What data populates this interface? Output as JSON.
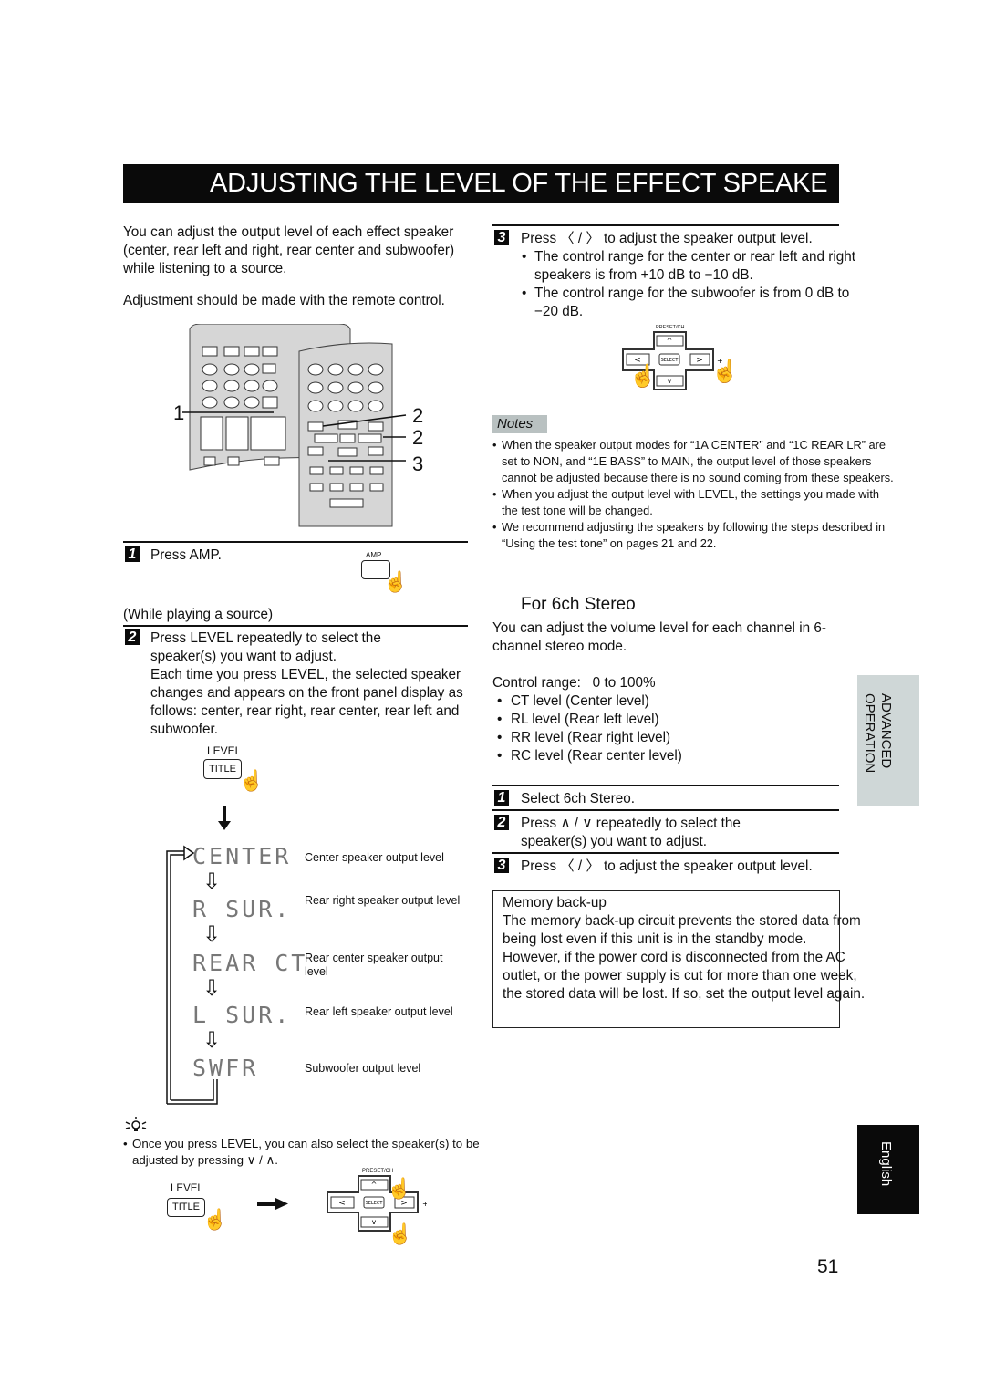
{
  "header": {
    "title": "ADJUSTING THE LEVEL OF THE EFFECT SPEAKE"
  },
  "intro": {
    "p1": "You can adjust the output level of each effect speaker (center, rear left and right, rear center and subwoofer) while listening to a source.",
    "p2": "Adjustment should be made with the remote control."
  },
  "remote_callouts": {
    "left": "1",
    "right_a": "2",
    "right_b": "2",
    "right_c": "3",
    "amp_label": "AMP"
  },
  "left_steps": {
    "step1_num": "1",
    "step1_text": "Press AMP.",
    "step1_key_label": "AMP",
    "while_playing": "(While playing a source)",
    "step2_num": "2",
    "step2_text": "Press LEVEL repeatedly to select the speaker(s) you want to adjust.",
    "step2_detail": "Each time you press LEVEL, the selected speaker changes and appears on the front panel display as follows: center, rear right, rear center, rear left and subwoofer.",
    "level_key_top": "LEVEL",
    "level_key_label": "TITLE"
  },
  "display_sequence": [
    {
      "lcd": "CENTER",
      "desc": "Center speaker output level"
    },
    {
      "lcd": "R SUR.",
      "desc": "Rear right speaker output level"
    },
    {
      "lcd": "REAR CT",
      "desc": "Rear center speaker output level"
    },
    {
      "lcd": "L SUR.",
      "desc": "Rear left speaker output level"
    },
    {
      "lcd": "SWFR",
      "desc": "Subwoofer output level"
    }
  ],
  "tip": {
    "icon": "lightbulb-icon",
    "text": "Once you press LEVEL, you can also select the speaker(s) to be adjusted by pressing ∨ / ∧.",
    "level_key_top": "LEVEL",
    "level_key_label": "TITLE",
    "preset_label": "PRESET/CH",
    "select_label": "SELECT",
    "plus": "+"
  },
  "right_step3": {
    "num": "3",
    "text": "Press 〈 / 〉 to adjust the speaker output level.",
    "bullets": [
      "The control range for the center or rear left and right speakers is from +10 dB to −10 dB.",
      "The control range for the subwoofer is from 0 dB to −20 dB."
    ],
    "preset_label": "PRESET/CH",
    "select_label": "SELECT",
    "plus": "+"
  },
  "notes": {
    "label": "Notes",
    "items": [
      "When the speaker output modes for “1A CENTER” and “1C REAR LR” are set to NON, and “1E BASS” to MAIN, the output level of those speakers cannot be adjusted because there is no sound coming from these speakers.",
      "When you adjust the output level with LEVEL, the settings you made with the test tone will be changed.",
      "We recommend adjusting the speakers by following the steps described in “Using the test tone” on pages 21 and 22."
    ]
  },
  "six_ch": {
    "heading": "For 6ch Stereo",
    "intro": "You can adjust the volume level for each channel in 6-channel stereo mode.",
    "control_range": "Control range:   0 to 100%",
    "levels": [
      "CT level  (Center level)",
      "RL level  (Rear left level)",
      "RR level  (Rear right level)",
      "RC level  (Rear center level)"
    ],
    "steps": [
      {
        "num": "1",
        "text": "Select 6ch Stereo."
      },
      {
        "num": "2",
        "text": "Press ∧ / ∨ repeatedly to select the speaker(s) you want to adjust."
      },
      {
        "num": "3",
        "text": "Press 〈 / 〉 to adjust the speaker output level."
      }
    ]
  },
  "memory_backup": {
    "title": "Memory back-up",
    "text": "The memory back-up circuit prevents the stored data from being lost even if this unit is in the standby mode. However, if the power cord is disconnected from the AC outlet, or the power supply is cut for more than one week, the stored data will be lost. If so, set the output level again."
  },
  "side_tabs": {
    "section": "ADVANCED OPERATION",
    "language": "English"
  },
  "footer": {
    "page_number": "51"
  }
}
